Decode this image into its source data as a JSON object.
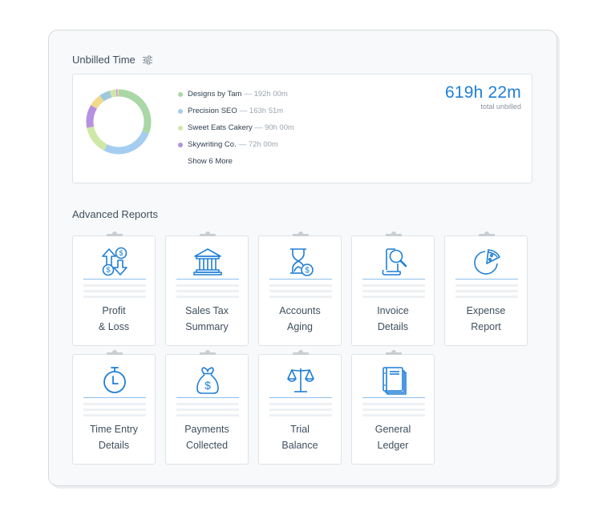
{
  "unbilled_time": {
    "title": "Unbilled Time",
    "filter_icon": "filter-sliders-icon",
    "total": "619h 22m",
    "total_label": "total unbilled",
    "clients": [
      {
        "name": "Designs by Tam",
        "hours": "192h 00m",
        "value": 192.0,
        "color": "#a9d8a6"
      },
      {
        "name": "Precision SEO",
        "hours": "163h 51m",
        "value": 163.85,
        "color": "#a4cdf0"
      },
      {
        "name": "Sweet Eats Cakery",
        "hours": "90h 00m",
        "value": 90.0,
        "color": "#cfe8a8"
      },
      {
        "name": "Skywriting Co.",
        "hours": "72h 00m",
        "value": 72.0,
        "color": "#b591df"
      }
    ],
    "hidden_segments": [
      {
        "value": 40.0,
        "color": "#f2da8c"
      },
      {
        "value": 34.0,
        "color": "#9ec9dd"
      },
      {
        "value": 20.0,
        "color": "#cfe8a8"
      },
      {
        "value": 3.0,
        "color": "#b591df"
      },
      {
        "value": 2.5,
        "color": "#f5b5c8"
      },
      {
        "value": 2.0,
        "color": "#f2da8c"
      }
    ],
    "show_more": "Show 6 More"
  },
  "advanced_reports": {
    "title": "Advanced Reports",
    "accent": "#1f7fd6",
    "reports": [
      {
        "line1": "Profit",
        "line2": "& Loss",
        "icon": "profit-loss-icon"
      },
      {
        "line1": "Sales Tax",
        "line2": "Summary",
        "icon": "bank-building-icon"
      },
      {
        "line1": "Accounts",
        "line2": "Aging",
        "icon": "hourglass-dollar-icon"
      },
      {
        "line1": "Invoice",
        "line2": "Details",
        "icon": "document-magnifier-icon"
      },
      {
        "line1": "Expense",
        "line2": "Report",
        "icon": "pie-chart-icon"
      },
      {
        "line1": "Time Entry",
        "line2": "Details",
        "icon": "stopwatch-icon"
      },
      {
        "line1": "Payments",
        "line2": "Collected",
        "icon": "money-bag-icon"
      },
      {
        "line1": "Trial",
        "line2": "Balance",
        "icon": "scales-icon"
      },
      {
        "line1": "General",
        "line2": "Ledger",
        "icon": "ledger-book-icon"
      }
    ]
  }
}
